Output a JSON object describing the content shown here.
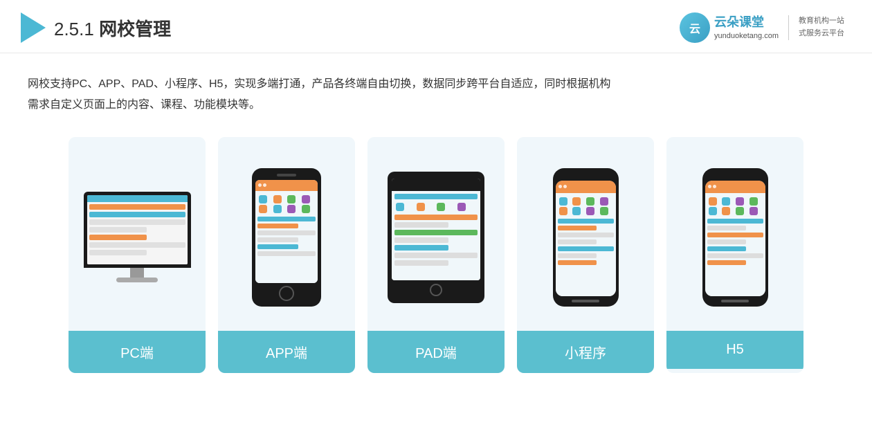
{
  "header": {
    "section": "2.5.1",
    "title": "网校管理",
    "brand": {
      "name": "云朵课堂",
      "url": "yunduoketang.com",
      "slogan_line1": "教育机构一站",
      "slogan_line2": "式服务云平台"
    }
  },
  "description": {
    "line1": "网校支持PC、APP、PAD、小程序、H5，实现多端打通，产品各终端自由切换，数据同步跨平台自适应，同时根据机构",
    "line2": "需求自定义页面上的内容、课程、功能模块等。"
  },
  "cards": [
    {
      "id": "pc",
      "label": "PC端"
    },
    {
      "id": "app",
      "label": "APP端"
    },
    {
      "id": "pad",
      "label": "PAD端"
    },
    {
      "id": "miniprogram",
      "label": "小程序"
    },
    {
      "id": "h5",
      "label": "H5"
    }
  ]
}
